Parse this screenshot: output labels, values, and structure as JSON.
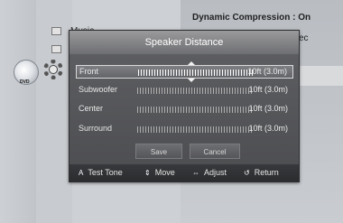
{
  "background": {
    "menu_item_music": "Music",
    "dvd_label": "DVD",
    "info_text": "Dynamic Compression : On",
    "info_text_clipped": "ec"
  },
  "dialog": {
    "title": "Speaker Distance",
    "rows": [
      {
        "label": "Front",
        "value": "10ft (3.0m)",
        "selected": true
      },
      {
        "label": "Subwoofer",
        "value": "10ft (3.0m)",
        "selected": false
      },
      {
        "label": "Center",
        "value": "10ft (3.0m)",
        "selected": false
      },
      {
        "label": "Surround",
        "value": "10ft (3.0m)",
        "selected": false
      }
    ],
    "save_label": "Save",
    "cancel_label": "Cancel"
  },
  "footer": {
    "test_tone_key": "A",
    "test_tone": "Test Tone",
    "move": "Move",
    "adjust": "Adjust",
    "return": "Return"
  },
  "colors": {
    "dialog_bg": "#4c4d50",
    "title_bar": "#8a8a8c",
    "selected_row": "#7f8083"
  }
}
